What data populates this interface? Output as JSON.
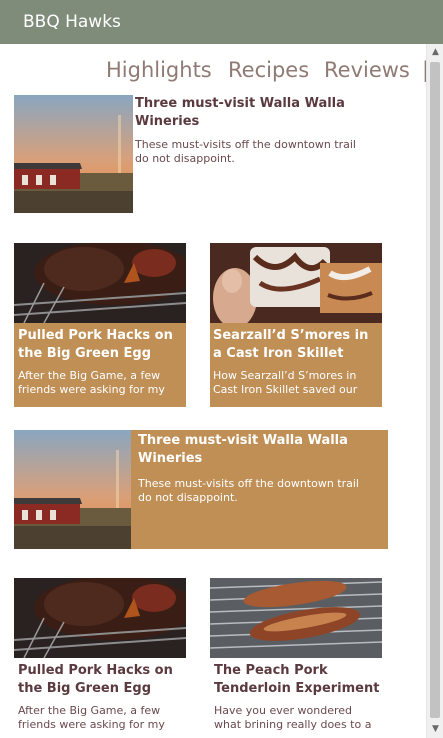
{
  "app": {
    "title": "BBQ Hawks"
  },
  "nav": {
    "tabs": [
      "Highlights",
      "Recipes",
      "Reviews"
    ]
  },
  "articles": [
    {
      "title": "Three must-visit Walla Walla Wineries",
      "desc": "These must-visits off the downtown trail do not disappoint.",
      "image": "winery-barn-sunset"
    },
    {
      "title": "Pulled Pork Hacks on the Big Green Egg",
      "desc": "After the Big Game, a few friends were asking for my",
      "image": "pulled-pork-grill"
    },
    {
      "title": "Searzall’d S’mores in a Cast Iron Skillet",
      "desc": "How Searzall’d S’mores in Cast Iron Skillet saved our",
      "image": "smores"
    },
    {
      "title": "Three must-visit Walla Walla Wineries",
      "desc": "These must-visits off the downtown trail do not disappoint.",
      "image": "winery-barn-sunset"
    },
    {
      "title": "Pulled Pork Hacks on the Big Green Egg",
      "desc": "After the Big Game, a few friends were asking for my",
      "image": "pulled-pork-grill"
    },
    {
      "title": "The Peach Pork Tenderloin Experiment",
      "desc": "Have you ever wondered what brining really does to a",
      "image": "pork-tenderloin-grill"
    }
  ],
  "colors": {
    "titlebar": "#7e8c79",
    "accent_tan": "#bf8f56",
    "title_text": "#5a3a3e",
    "nav_text": "#8f7b74"
  }
}
